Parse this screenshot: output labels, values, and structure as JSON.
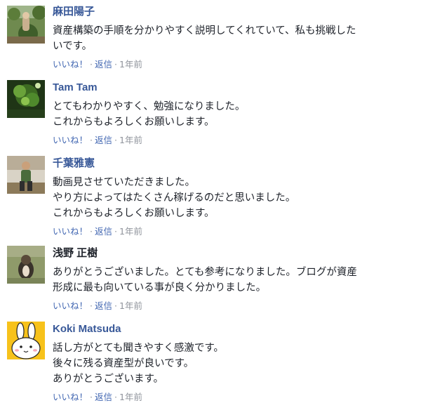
{
  "comments": [
    {
      "author": "麻田陽子",
      "author_link": true,
      "lines": [
        "資産構築の手順を分かりやすく説明してくれていて、私も挑戦した",
        "いです。"
      ],
      "like": "いいね！",
      "reply": "返信",
      "time": "1年前",
      "avatar": "garden-photo"
    },
    {
      "author": "Tam Tam",
      "author_link": true,
      "lines": [
        "とてもわかりやすく、勉強になりました。",
        "これからもよろしくお願いします。"
      ],
      "like": "いいね！",
      "reply": "返信",
      "time": "1年前",
      "avatar": "green-tree-photo"
    },
    {
      "author": "千葉雅憲",
      "author_link": true,
      "lines": [
        "動画見させていただきました。",
        "やり方によってはたくさん稼げるのだと思いました。",
        "これからもよろしくお願いします。"
      ],
      "like": "いいね！",
      "reply": "返信",
      "time": "1年前",
      "avatar": "person-photo"
    },
    {
      "author": "浅野 正樹",
      "author_link": false,
      "lines": [
        "ありがとうございました。とても参考になりました。ブログが資産",
        "形成に最も向いている事が良く分かりました。"
      ],
      "like": "いいね！",
      "reply": "返信",
      "time": "1年前",
      "avatar": "dog-photo"
    },
    {
      "author": "Koki Matsuda",
      "author_link": true,
      "lines": [
        "話し方がとても聞きやすく感激です。",
        "後々に残る資産型が良いです。",
        "ありがとうございます。"
      ],
      "like": "いいね！",
      "reply": "返信",
      "time": "1年前",
      "avatar": "rabbit-illustration"
    }
  ],
  "colors": {
    "link": "#385898",
    "action_link": "#4267b2",
    "meta": "#90949c",
    "text": "#1d2129"
  }
}
